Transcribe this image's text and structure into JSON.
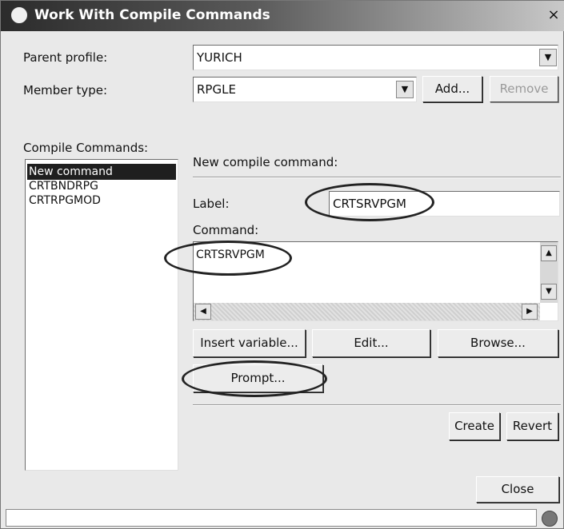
{
  "window": {
    "title": "Work With Compile Commands",
    "close_glyph": "×"
  },
  "parent_profile": {
    "label": "Parent profile:",
    "value": "YURICH"
  },
  "member_type": {
    "label": "Member type:",
    "value": "RPGLE",
    "add_label": "Add...",
    "remove_label": "Remove"
  },
  "compile_commands": {
    "label": "Compile Commands:",
    "items": [
      "New command",
      "CRTBNDRPG",
      "CRTRPGMOD"
    ],
    "selected": "New command"
  },
  "new_command": {
    "section_label": "New compile command:",
    "label_label": "Label:",
    "label_value": "CRTSRVPGM",
    "command_label": "Command:",
    "command_value": "CRTSRVPGM"
  },
  "buttons": {
    "insert_variable": "Insert variable...",
    "edit": "Edit...",
    "browse": "Browse...",
    "prompt": "Prompt...",
    "create": "Create",
    "revert": "Revert",
    "close": "Close"
  },
  "icons": {
    "dropdown": "▼",
    "scroll_up": "▲",
    "scroll_down": "▼",
    "scroll_left": "◀",
    "scroll_right": "▶"
  }
}
